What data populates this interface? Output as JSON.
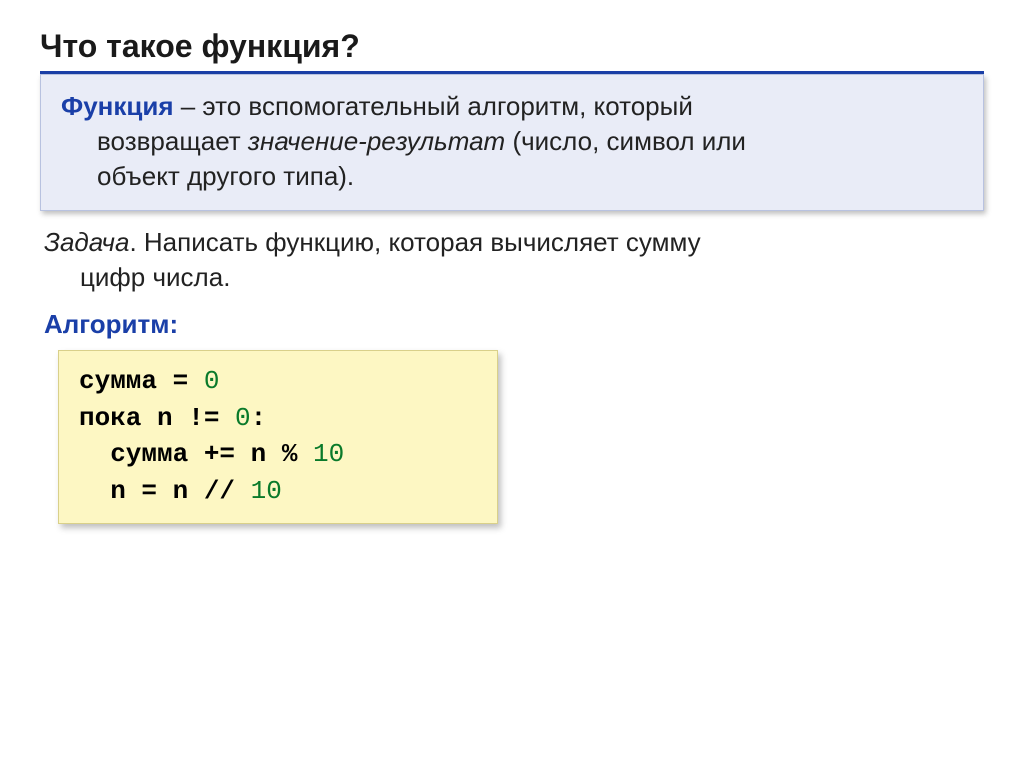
{
  "title": "Что такое функция?",
  "definition": {
    "term": "Функция",
    "line1_rest": " – это вспомогательный алгоритм, который",
    "line2_pre": "возвращает ",
    "line2_ital": "значение-результат",
    "line2_post": " (число, символ или",
    "line3": "объект другого типа)."
  },
  "task": {
    "label": "Задача",
    "line1_rest": ". Написать функцию, которая вычисляет сумму",
    "line2": "цифр числа."
  },
  "algo_label": "Алгоритм:",
  "code": {
    "l1_a": "сумма = ",
    "l1_n": "0",
    "l2_a": "пока n != ",
    "l2_n": "0",
    "l2_c": ":",
    "l3_a": "  сумма += n % ",
    "l3_n": "10",
    "l4_a": "  n = n // ",
    "l4_n": "10"
  }
}
